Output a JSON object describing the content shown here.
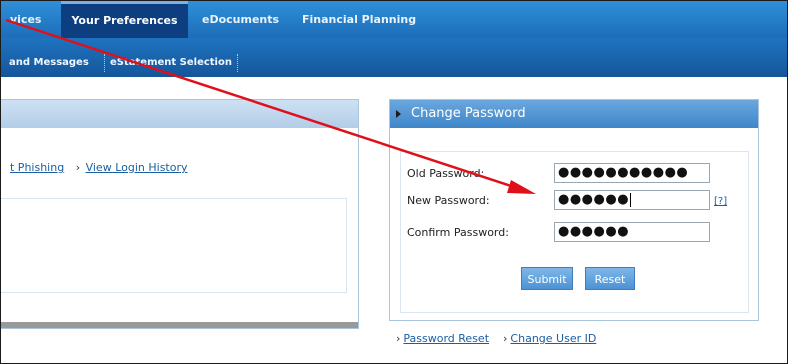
{
  "top_nav": {
    "services": "vices",
    "your_preferences": "Your Preferences",
    "edocuments": "eDocuments",
    "financial_planning": "Financial Planning"
  },
  "sub_nav": {
    "alerts_messages": "and Messages",
    "estatement_selection": "eStatement Selection"
  },
  "left_panel": {
    "phishing_link": "t Phishing",
    "view_login_history": "View Login History"
  },
  "change_password": {
    "title": "Change Password",
    "old_label": "Old Password:",
    "old_value": "●●●●●●●●●●●",
    "new_label": "New Password:",
    "new_value": "●●●●●●",
    "confirm_label": "Confirm Password:",
    "confirm_value": "●●●●●●",
    "help": "[?]",
    "submit": "Submit",
    "reset": "Reset"
  },
  "bottom_links": {
    "password_reset": "Password Reset",
    "change_user_id": "Change User ID"
  },
  "colors": {
    "nav_blue": "#1d6db9",
    "active_tab": "#0c3e80",
    "annotation_red": "#e0101a"
  }
}
